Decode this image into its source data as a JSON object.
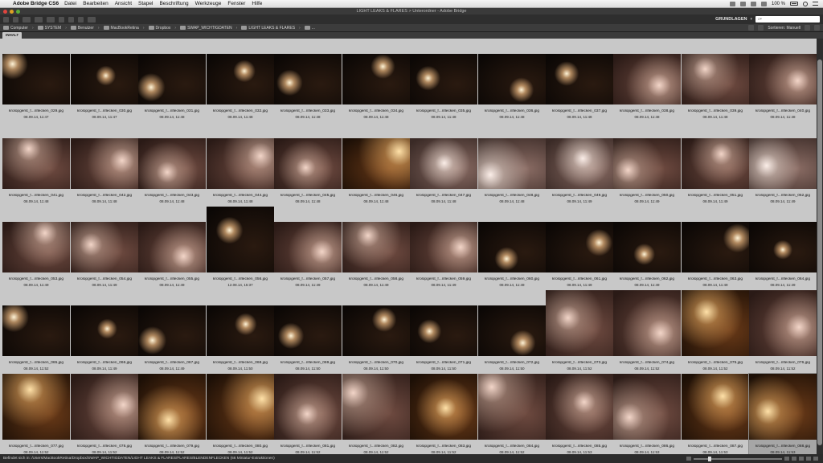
{
  "menubar": {
    "app_name": "Adobe Bridge CS6",
    "items": [
      "Datei",
      "Bearbeiten",
      "Ansicht",
      "Stapel",
      "Beschriftung",
      "Werkzeuge",
      "Fenster",
      "Hilfe"
    ],
    "battery": "100 %"
  },
  "window": {
    "title": "LIGHT LEAKS & FLARES > Unterordner - Adobe Bridge"
  },
  "toolbar": {
    "workspace": "GRUNDLAGEN",
    "search_placeholder": "⌕▾"
  },
  "pathbar": {
    "crumbs": [
      "Computer",
      "SYSTEM",
      "Benutzer",
      "MacBookRetina",
      "Dropbox",
      "SWAP_WICHTIGDATEN",
      "LIGHT LEAKS & FLARES",
      "..."
    ],
    "sort_label": "Sortieren: Manuell"
  },
  "panel": {
    "tab_label": "INHALT"
  },
  "thumbnails": [
    {
      "name": "krolopgerst_f...nflecken_029.jpg",
      "date": "08.09.14, 11:47",
      "tone": "dark"
    },
    {
      "name": "krolopgerst_f...nflecken_030.jpg",
      "date": "08.09.14, 11:47",
      "tone": "dark"
    },
    {
      "name": "krolopgerst_f...nflecken_031.jpg",
      "date": "08.09.14, 11:48",
      "tone": "dark"
    },
    {
      "name": "krolopgerst_f...nflecken_032.jpg",
      "date": "08.09.14, 11:48",
      "tone": "dark"
    },
    {
      "name": "krolopgerst_f...nflecken_033.jpg",
      "date": "08.09.14, 11:48",
      "tone": "dark"
    },
    {
      "name": "krolopgerst_f...nflecken_034.jpg",
      "date": "08.09.14, 11:48",
      "tone": "dark"
    },
    {
      "name": "krolopgerst_f...nflecken_035.jpg",
      "date": "08.09.14, 11:48",
      "tone": "dark"
    },
    {
      "name": "krolopgerst_f...nflecken_036.jpg",
      "date": "08.09.14, 11:48",
      "tone": "dark"
    },
    {
      "name": "krolopgerst_f...nflecken_037.jpg",
      "date": "08.09.14, 11:48",
      "tone": "dark"
    },
    {
      "name": "krolopgerst_f...nflecken_038.jpg",
      "date": "08.09.14, 11:48",
      "tone": "pink"
    },
    {
      "name": "krolopgerst_f...nflecken_039.jpg",
      "date": "08.09.14, 11:48",
      "tone": "pink"
    },
    {
      "name": "krolopgerst_f...nflecken_040.jpg",
      "date": "08.09.14, 11:48",
      "tone": "pink"
    },
    {
      "name": "krolopgerst_f...nflecken_041.jpg",
      "date": "08.09.14, 11:48",
      "tone": "pink"
    },
    {
      "name": "krolopgerst_f...nflecken_042.jpg",
      "date": "08.09.14, 11:48",
      "tone": "pink"
    },
    {
      "name": "krolopgerst_f...nflecken_043.jpg",
      "date": "08.09.14, 11:48",
      "tone": "pink"
    },
    {
      "name": "krolopgerst_f...nflecken_044.jpg",
      "date": "08.09.14, 11:48",
      "tone": "pink"
    },
    {
      "name": "krolopgerst_f...nflecken_045.jpg",
      "date": "08.09.14, 11:48",
      "tone": "pink"
    },
    {
      "name": "krolopgerst_f...nflecken_046.jpg",
      "date": "08.09.14, 11:48",
      "tone": "amber"
    },
    {
      "name": "krolopgerst_f...nflecken_047.jpg",
      "date": "08.09.14, 11:48",
      "tone": "light"
    },
    {
      "name": "krolopgerst_f...nflecken_048.jpg",
      "date": "08.09.14, 11:48",
      "tone": "light"
    },
    {
      "name": "krolopgerst_f...nflecken_049.jpg",
      "date": "08.09.14, 11:49",
      "tone": "light"
    },
    {
      "name": "krolopgerst_f...nflecken_050.jpg",
      "date": "08.09.14, 11:49",
      "tone": "pink"
    },
    {
      "name": "krolopgerst_f...nflecken_051.jpg",
      "date": "08.09.14, 11:49",
      "tone": "pink"
    },
    {
      "name": "krolopgerst_f...nflecken_052.jpg",
      "date": "08.09.14, 11:49",
      "tone": "light"
    },
    {
      "name": "krolopgerst_f...nflecken_053.jpg",
      "date": "08.09.14, 11:49",
      "tone": "pink"
    },
    {
      "name": "krolopgerst_f...nflecken_054.jpg",
      "date": "08.09.14, 11:49",
      "tone": "pink"
    },
    {
      "name": "krolopgerst_f...nflecken_055.jpg",
      "date": "08.09.14, 11:49",
      "tone": "pink"
    },
    {
      "name": "krolopgerst_f...nflecken_056.jpg",
      "date": "12.08.14, 15:37",
      "tone": "dark",
      "portrait": true
    },
    {
      "name": "krolopgerst_f...nflecken_057.jpg",
      "date": "08.09.14, 11:49",
      "tone": "pink"
    },
    {
      "name": "krolopgerst_f...nflecken_058.jpg",
      "date": "08.09.14, 11:49",
      "tone": "pink"
    },
    {
      "name": "krolopgerst_f...nflecken_059.jpg",
      "date": "08.09.14, 11:49",
      "tone": "pink"
    },
    {
      "name": "krolopgerst_f...nflecken_060.jpg",
      "date": "08.09.14, 11:49",
      "tone": "dark"
    },
    {
      "name": "krolopgerst_f...nflecken_061.jpg",
      "date": "08.09.14, 11:49",
      "tone": "dark"
    },
    {
      "name": "krolopgerst_f...nflecken_062.jpg",
      "date": "08.09.14, 11:49",
      "tone": "dark"
    },
    {
      "name": "krolopgerst_f...nflecken_063.jpg",
      "date": "08.09.14, 11:49",
      "tone": "dark"
    },
    {
      "name": "krolopgerst_f...nflecken_064.jpg",
      "date": "08.09.14, 11:49",
      "tone": "dark"
    },
    {
      "name": "krolopgerst_f...nflecken_065.jpg",
      "date": "08.09.14, 11:52",
      "tone": "dark"
    },
    {
      "name": "krolopgerst_f...nflecken_066.jpg",
      "date": "08.09.14, 11:49",
      "tone": "dark"
    },
    {
      "name": "krolopgerst_f...nflecken_067.jpg",
      "date": "08.09.14, 11:49",
      "tone": "dark"
    },
    {
      "name": "krolopgerst_f...nflecken_068.jpg",
      "date": "08.09.14, 11:50",
      "tone": "dark"
    },
    {
      "name": "krolopgerst_f...nflecken_069.jpg",
      "date": "08.09.14, 11:50",
      "tone": "dark"
    },
    {
      "name": "krolopgerst_f...nflecken_070.jpg",
      "date": "08.09.14, 11:50",
      "tone": "dark"
    },
    {
      "name": "krolopgerst_f...nflecken_071.jpg",
      "date": "08.09.14, 11:50",
      "tone": "dark"
    },
    {
      "name": "krolopgerst_f...nflecken_072.jpg",
      "date": "08.09.14, 11:50",
      "tone": "dark"
    },
    {
      "name": "krolopgerst_f...nflecken_073.jpg",
      "date": "08.09.14, 11:52",
      "tone": "pink",
      "portrait": true
    },
    {
      "name": "krolopgerst_f...nflecken_074.jpg",
      "date": "08.09.14, 11:52",
      "tone": "pink",
      "portrait": true
    },
    {
      "name": "krolopgerst_f...nflecken_075.jpg",
      "date": "08.09.14, 11:52",
      "tone": "amber",
      "portrait": true
    },
    {
      "name": "krolopgerst_f...nflecken_076.jpg",
      "date": "08.09.14, 11:52",
      "tone": "pink",
      "portrait": true
    },
    {
      "name": "krolopgerst_f...nflecken_077.jpg",
      "date": "08.09.14, 11:52",
      "tone": "amber",
      "portrait": true
    },
    {
      "name": "krolopgerst_f...nflecken_078.jpg",
      "date": "08.09.14, 11:52",
      "tone": "pink",
      "portrait": true
    },
    {
      "name": "krolopgerst_f...nflecken_079.jpg",
      "date": "08.09.14, 11:52",
      "tone": "amber",
      "portrait": true
    },
    {
      "name": "krolopgerst_f...nflecken_080.jpg",
      "date": "08.09.14, 11:52",
      "tone": "amber",
      "portrait": true
    },
    {
      "name": "krolopgerst_f...nflecken_081.jpg",
      "date": "08.09.14, 11:52",
      "tone": "pink",
      "portrait": true
    },
    {
      "name": "krolopgerst_f...nflecken_082.jpg",
      "date": "08.09.14, 11:52",
      "tone": "pink",
      "portrait": true
    },
    {
      "name": "krolopgerst_f...nflecken_083.jpg",
      "date": "08.09.14, 11:52",
      "tone": "amber",
      "portrait": true
    },
    {
      "name": "krolopgerst_f...nflecken_084.jpg",
      "date": "08.09.14, 11:52",
      "tone": "pink",
      "portrait": true
    },
    {
      "name": "krolopgerst_f...nflecken_085.jpg",
      "date": "08.09.14, 11:53",
      "tone": "pink",
      "portrait": true
    },
    {
      "name": "krolopgerst_f...nflecken_086.jpg",
      "date": "08.09.14, 11:53",
      "tone": "pink",
      "portrait": true
    },
    {
      "name": "krolopgerst_f...nflecken_087.jpg",
      "date": "08.09.14, 11:53",
      "tone": "amber",
      "portrait": true
    },
    {
      "name": "krolopgerst_f...nflecken_088.jpg",
      "date": "08.09.14, 11:53",
      "tone": "amber",
      "portrait": true,
      "selected": true
    }
  ],
  "statusbar": {
    "text": "Befindet sich in: /Users/MacBookRetina/Dropbox/SWAP_WICHTIGDATEN/LIGHT LEAKS & FLARES/FLARES/BLENDENFLECKEN (66 Miniatur-Extraktionen)"
  },
  "colors": {
    "panel_bg": "#c8c8c8",
    "chrome_dark": "#2e2e2e",
    "selection": "#a6a6a6"
  }
}
